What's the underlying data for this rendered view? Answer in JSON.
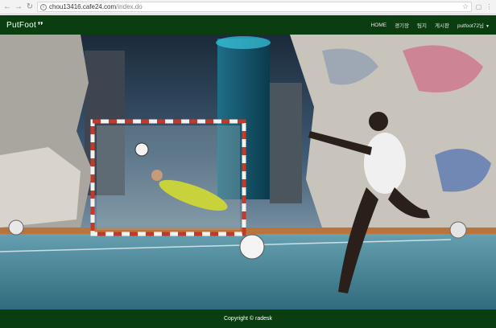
{
  "browser": {
    "back_icon": "back-arrow-icon",
    "forward_icon": "forward-arrow-icon",
    "reload_icon": "reload-icon",
    "url_host": "chou13416.cafe24.com",
    "url_path": "/index.do"
  },
  "site": {
    "brand": "PutFoot",
    "menu": {
      "home": "HOME",
      "item2": "경기장",
      "item3": "팀지",
      "item4": "게시판",
      "user": "putfoot72님"
    }
  },
  "footer": {
    "copyright": "Copyright © radesk"
  },
  "colors": {
    "nav_bg": "#0a3d0f",
    "footer_bg": "#0a3d0f"
  }
}
